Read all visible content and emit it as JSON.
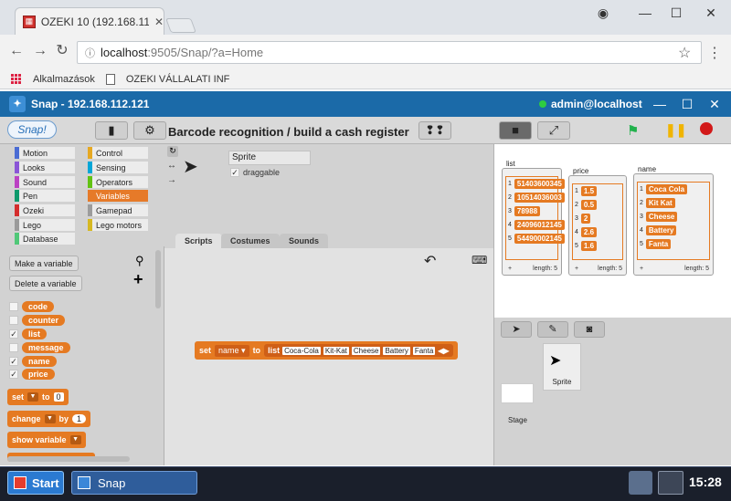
{
  "browser": {
    "tab_title": "OZEKI 10 (192.168.112.12",
    "url_host": "localhost",
    "url_path": ":9505/Snap/?a=Home",
    "bookmarks": [
      "Alkalmazások",
      "OZEKI VÁLLALATI INF"
    ]
  },
  "snap_window": {
    "title": "Snap - 192.168.112.121",
    "user": "admin@localhost"
  },
  "snap": {
    "logo": "Snap!",
    "project_title": "Barcode recognition / build a cash register",
    "categories": [
      "Motion",
      "Looks",
      "Sound",
      "Pen",
      "Ozeki",
      "Lego",
      "Database",
      "Control",
      "Sensing",
      "Operators",
      "Variables",
      "Gamepad",
      "Lego motors"
    ],
    "category_colors": [
      "#4a6cd4",
      "#8a55d7",
      "#bb42c3",
      "#0e9a6c",
      "#d42d2d",
      "#9a9a9a",
      "#50c878",
      "#e6a822",
      "#04a6d7",
      "#62c213",
      "#e67a29",
      "#9c9c9c",
      "#d6b822"
    ],
    "selected_category": "Variables",
    "make_variable": "Make a variable",
    "delete_variable": "Delete a variable",
    "variables": [
      {
        "name": "code",
        "checked": false
      },
      {
        "name": "counter",
        "checked": false
      },
      {
        "name": "list",
        "checked": true
      },
      {
        "name": "message",
        "checked": false
      },
      {
        "name": "name",
        "checked": true
      },
      {
        "name": "price",
        "checked": true
      }
    ],
    "palette_blocks": {
      "set": "set",
      "to": "to",
      "set_value": "0",
      "change": "change",
      "by": "by",
      "change_value": "1",
      "show_variable": "show variable"
    },
    "sprite_name": "Sprite",
    "draggable": "draggable",
    "tabs": [
      "Scripts",
      "Costumes",
      "Sounds"
    ],
    "script_block": {
      "set": "set",
      "var": "name",
      "to": "to",
      "list": "list",
      "items": [
        "Coca-Cola",
        "Kit-Kat",
        "Cheese",
        "Battery",
        "Fanta"
      ]
    },
    "watchers": [
      {
        "label": "list",
        "values": [
          "51403600345",
          "10514036003",
          "78988",
          "24096012145",
          "54490002145"
        ],
        "footer": "length: 5"
      },
      {
        "label": "price",
        "values": [
          "1.5",
          "0.5",
          "2",
          "2.6",
          "1.6"
        ],
        "footer": "length: 5"
      },
      {
        "label": "name",
        "values": [
          "Coca Cola",
          "Kit Kat",
          "Cheese",
          "Battery",
          "Fanta"
        ],
        "footer": "length: 5"
      }
    ],
    "corral_sprite": "Sprite",
    "stage_label": "Stage"
  },
  "taskbar": {
    "start": "Start",
    "app": "Snap",
    "clock": "15:28"
  }
}
